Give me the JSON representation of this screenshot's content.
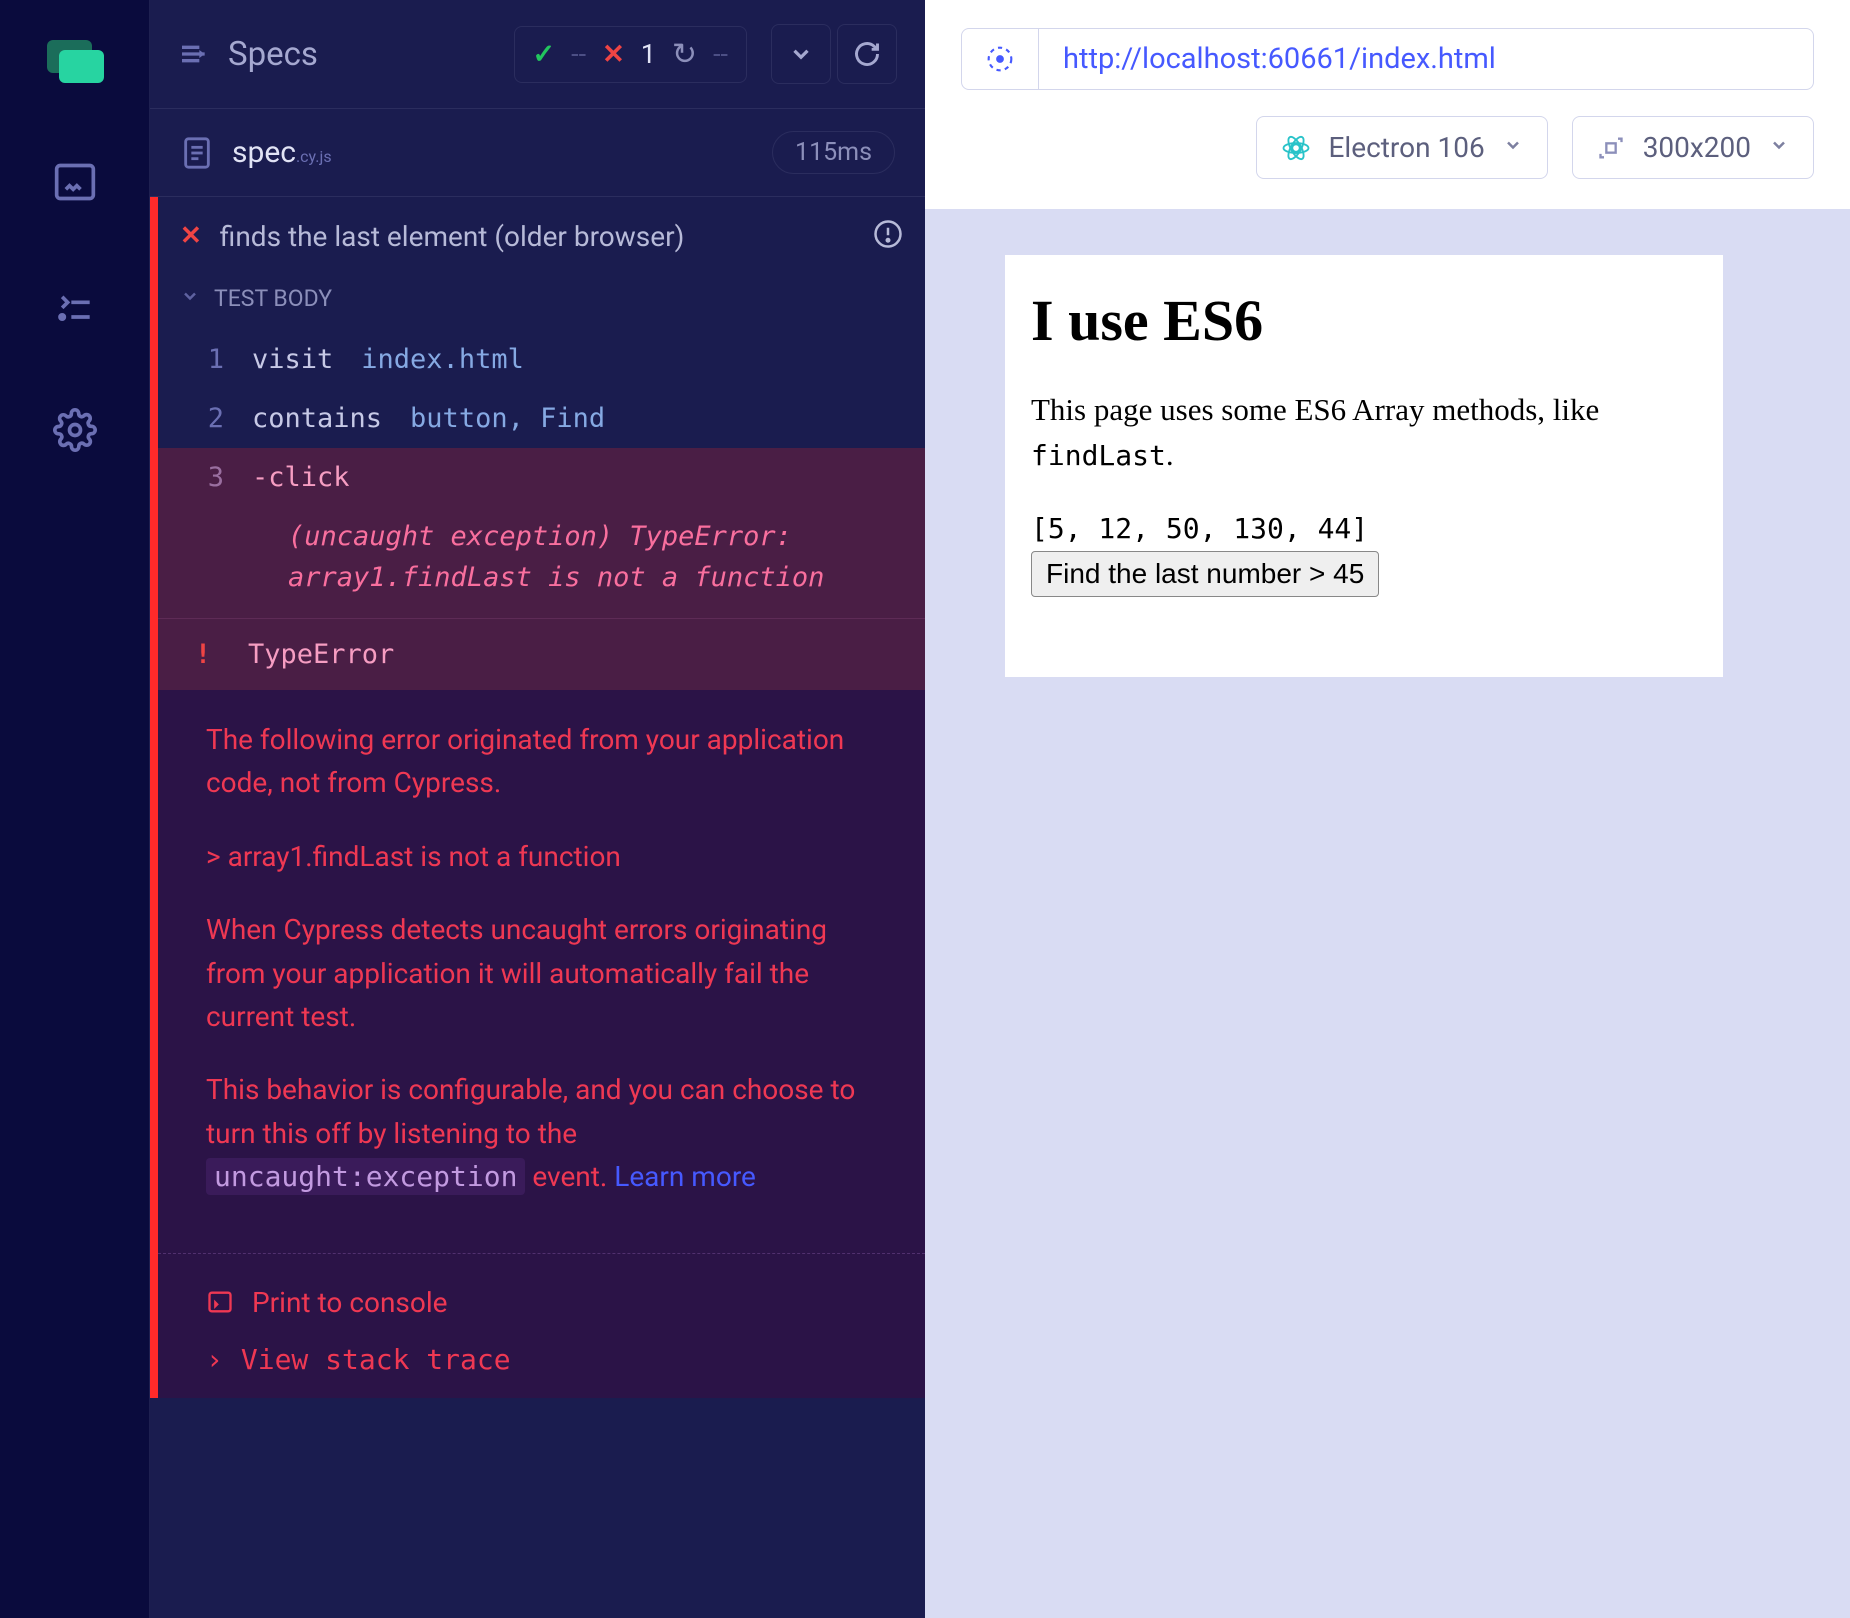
{
  "header": {
    "specs_label": "Specs",
    "pass_count": "--",
    "fail_count": "1",
    "pending_count": "--"
  },
  "spec_file": {
    "name": "spec",
    "ext": ".cy.js",
    "duration": "115ms"
  },
  "test": {
    "title": "finds the last element (older browser)",
    "body_label": "TEST BODY",
    "commands": [
      {
        "num": "1",
        "cmd": "visit",
        "arg": "index.html",
        "err": false
      },
      {
        "num": "2",
        "cmd": "contains",
        "arg": "button, Find",
        "err": false
      },
      {
        "num": "3",
        "cmd": "-click",
        "arg": "",
        "err": true
      }
    ],
    "exception_line": "(uncaught exception)  TypeError: array1.findLast is not a function",
    "error_type": "TypeError",
    "error_detail": {
      "p1": "The following error originated from your application code, not from Cypress.",
      "p2": "> array1.findLast is not a function",
      "p3": "When Cypress detects uncaught errors originating from your application it will automatically fail the current test.",
      "p4a": "This behavior is configurable, and you can choose to turn this off by listening to the ",
      "p4_code": "uncaught:exception",
      "p4b": " event. ",
      "learn_more": "Learn more"
    },
    "actions": {
      "print": "Print to console",
      "view_stack": "View stack trace"
    }
  },
  "preview": {
    "url": "http://localhost:60661/index.html",
    "browser": "Electron 106",
    "viewport": "300x200",
    "page": {
      "h1": "I use ES6",
      "p_a": "This page uses some ES6 Array methods, like ",
      "p_code": "findLast",
      "p_b": ".",
      "array": "[5, 12, 50, 130, 44]",
      "button": "Find the last number > 45"
    }
  }
}
